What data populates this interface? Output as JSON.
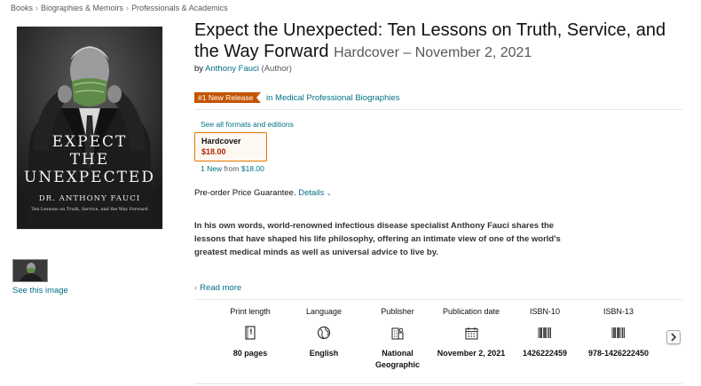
{
  "breadcrumb": {
    "items": [
      "Books",
      "Biographies & Memoirs",
      "Professionals & Academics"
    ],
    "separator": "›"
  },
  "cover": {
    "title_lines": [
      "EXPECT",
      "THE",
      "UNEXPECTED"
    ],
    "author": "DR. ANTHONY FAUCI",
    "subtitle": "Ten Lessons on Truth, Service, and the Way Forward"
  },
  "gallery": {
    "see_image_label": "See this image"
  },
  "product": {
    "title": "Expect the Unexpected: Ten Lessons on Truth, Service, and the Way Forward",
    "format_date": "Hardcover – November 2, 2021",
    "by_label": "by",
    "author": "Anthony Fauci",
    "author_role": "(Author)"
  },
  "badge": {
    "label": "#1 New Release",
    "category": "in Medical Professional Biographies",
    "color": "#c45500"
  },
  "formats": {
    "see_all_label": "See all formats and editions",
    "selected": {
      "name": "Hardcover",
      "price": "$18.00"
    },
    "new_count": "1 New",
    "from_label": "from",
    "from_price": "$18.00"
  },
  "preorder": {
    "text": "Pre-order Price Guarantee.",
    "details_label": "Details"
  },
  "description": "In his own words, world-renowned infectious disease specialist Anthony Fauci shares the lessons that have shaped his life philosophy, offering an intimate view of one of the world's greatest medical minds as well as universal advice to live by.",
  "read_more": {
    "chevron": "‹",
    "label": "Read more"
  },
  "details": [
    {
      "label": "Print length",
      "icon": "book-pages-icon",
      "value": "80 pages"
    },
    {
      "label": "Language",
      "icon": "globe-icon",
      "value": "English"
    },
    {
      "label": "Publisher",
      "icon": "building-icon",
      "value": "National Geographic"
    },
    {
      "label": "Publication date",
      "icon": "calendar-icon",
      "value": "November 2, 2021"
    },
    {
      "label": "ISBN-10",
      "icon": "barcode-icon",
      "value": "1426222459"
    },
    {
      "label": "ISBN-13",
      "icon": "barcode-icon",
      "value": "978-1426222450"
    }
  ],
  "colors": {
    "link": "#007185",
    "price": "#b12704",
    "format_border": "#e77600"
  }
}
